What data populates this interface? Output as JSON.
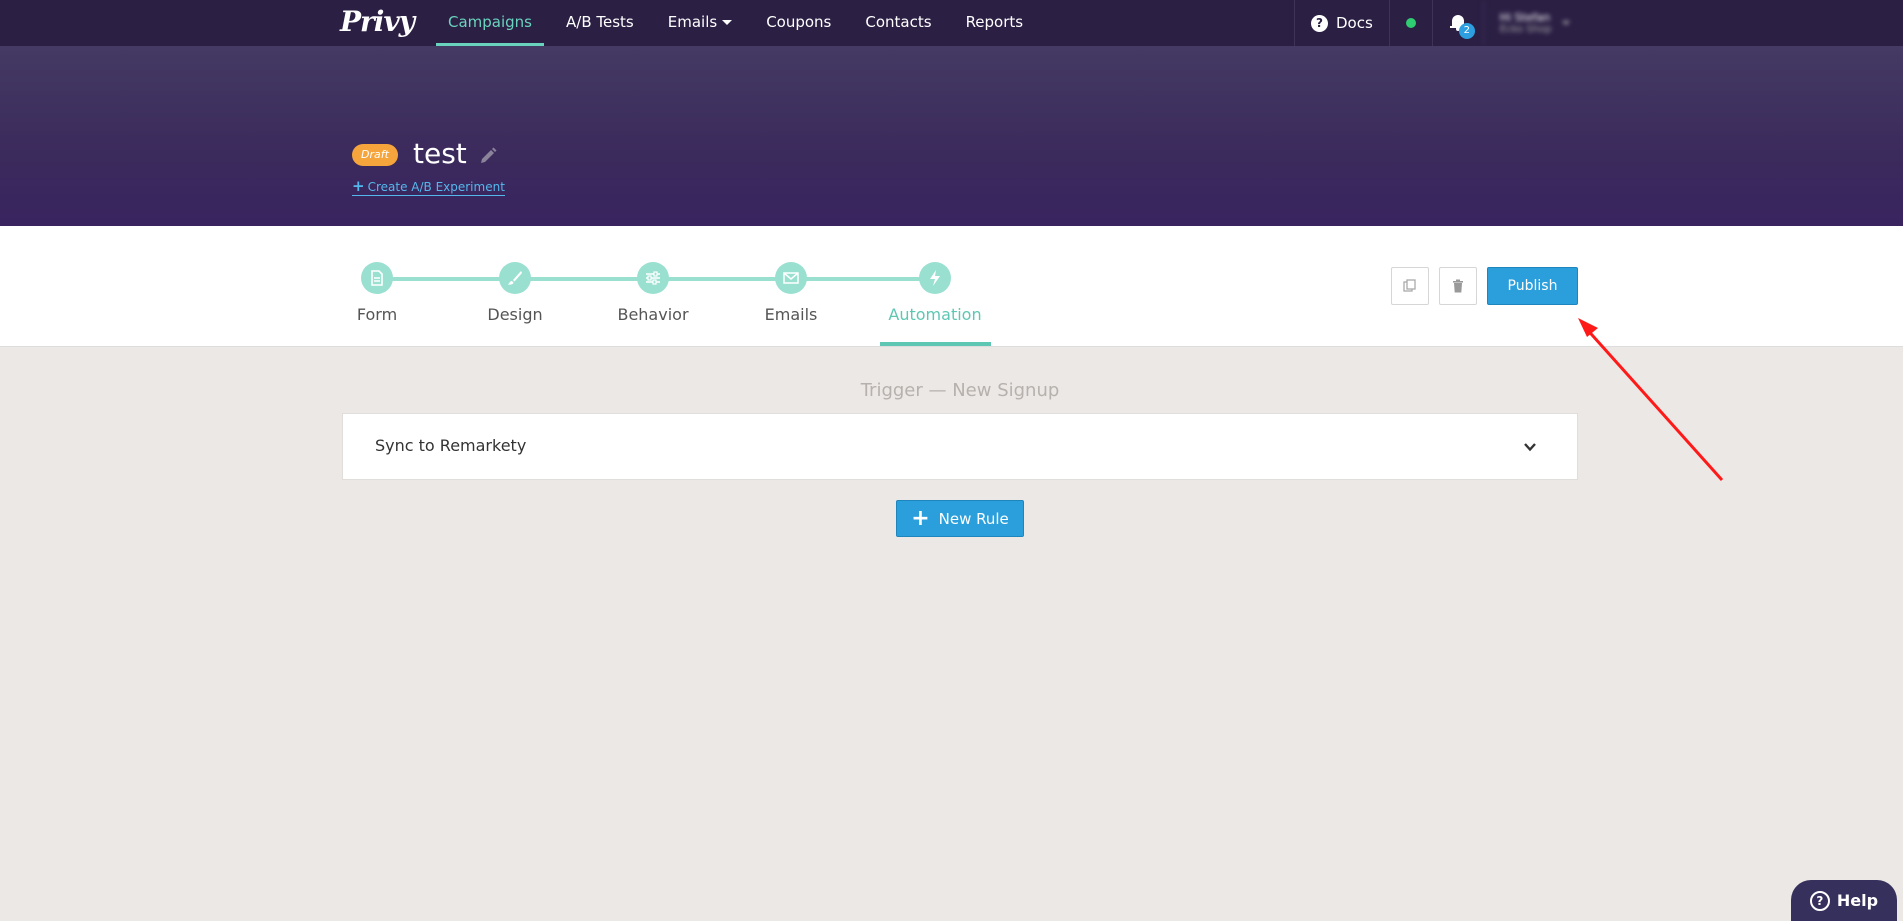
{
  "nav": {
    "logo": "Privy",
    "links": [
      {
        "label": "Campaigns"
      },
      {
        "label": "A/B Tests"
      },
      {
        "label": "Emails"
      },
      {
        "label": "Coupons"
      },
      {
        "label": "Contacts"
      },
      {
        "label": "Reports"
      }
    ],
    "docs_label": "Docs",
    "notification_count": "2",
    "user": {
      "name": "Hi Stefan",
      "store": "Ecko Shop"
    }
  },
  "campaign": {
    "status": "Draft",
    "title": "test",
    "ab_link": "Create A/B Experiment"
  },
  "steps": [
    {
      "label": "Form",
      "icon": "document-icon"
    },
    {
      "label": "Design",
      "icon": "brush-icon"
    },
    {
      "label": "Behavior",
      "icon": "sliders-icon"
    },
    {
      "label": "Emails",
      "icon": "envelope-icon"
    },
    {
      "label": "Automation",
      "icon": "bolt-icon"
    }
  ],
  "toolbar": {
    "publish_label": "Publish"
  },
  "automation": {
    "trigger_title": "Trigger — New Signup",
    "rules": [
      {
        "name": "Sync to Remarkety"
      }
    ],
    "new_rule_label": "New Rule"
  },
  "help_label": "Help",
  "colors": {
    "nav_bg": "#2b1f44",
    "accent_teal": "#6ad3bd",
    "primary_blue": "#2b9fdb",
    "draft_orange": "#f5a53b"
  }
}
